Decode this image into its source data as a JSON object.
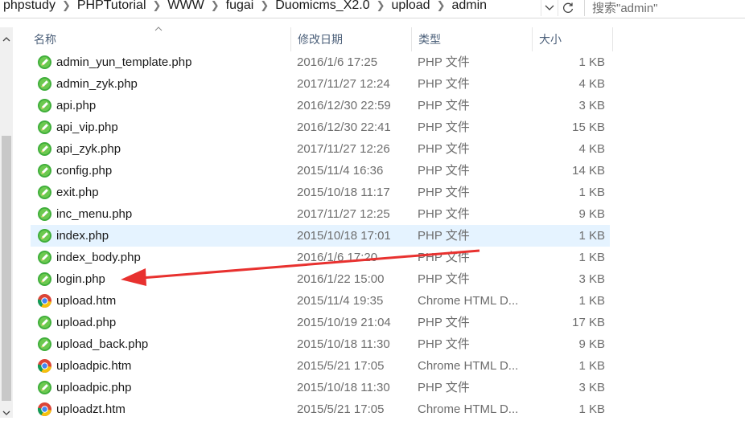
{
  "address_bar": {
    "crumbs": [
      "phpstudy",
      "PHPTutorial",
      "WWW",
      "fugai",
      "Duomicms_X2.0",
      "upload",
      "admin"
    ],
    "search_placeholder": "搜索\"admin\""
  },
  "columns": {
    "name": "名称",
    "date": "修改日期",
    "type": "类型",
    "size": "大小"
  },
  "colors": {
    "selected_row": "#e5f3ff",
    "header_text": "#4c607a",
    "arrow": "#e8312f"
  },
  "files": [
    {
      "name": "admin_yun_template.php",
      "date": "2016/1/6 17:25",
      "type": "PHP 文件",
      "size": "1 KB",
      "icon": "php-file-icon"
    },
    {
      "name": "admin_zyk.php",
      "date": "2017/11/27 12:24",
      "type": "PHP 文件",
      "size": "4 KB",
      "icon": "php-file-icon"
    },
    {
      "name": "api.php",
      "date": "2016/12/30 22:59",
      "type": "PHP 文件",
      "size": "3 KB",
      "icon": "php-file-icon"
    },
    {
      "name": "api_vip.php",
      "date": "2016/12/30 22:41",
      "type": "PHP 文件",
      "size": "15 KB",
      "icon": "php-file-icon"
    },
    {
      "name": "api_zyk.php",
      "date": "2017/11/27 12:26",
      "type": "PHP 文件",
      "size": "4 KB",
      "icon": "php-file-icon"
    },
    {
      "name": "config.php",
      "date": "2015/11/4 16:36",
      "type": "PHP 文件",
      "size": "14 KB",
      "icon": "php-file-icon"
    },
    {
      "name": "exit.php",
      "date": "2015/10/18 11:17",
      "type": "PHP 文件",
      "size": "1 KB",
      "icon": "php-file-icon"
    },
    {
      "name": "inc_menu.php",
      "date": "2017/11/27 12:25",
      "type": "PHP 文件",
      "size": "9 KB",
      "icon": "php-file-icon"
    },
    {
      "name": "index.php",
      "date": "2015/10/18 17:01",
      "type": "PHP 文件",
      "size": "1 KB",
      "icon": "php-file-icon",
      "selected": true
    },
    {
      "name": "index_body.php",
      "date": "2016/1/6 17:20",
      "type": "PHP 文件",
      "size": "1 KB",
      "icon": "php-file-icon"
    },
    {
      "name": "login.php",
      "date": "2016/1/22 15:00",
      "type": "PHP 文件",
      "size": "3 KB",
      "icon": "php-file-icon"
    },
    {
      "name": "upload.htm",
      "date": "2015/11/4 19:35",
      "type": "Chrome HTML D...",
      "size": "1 KB",
      "icon": "chrome-html-icon"
    },
    {
      "name": "upload.php",
      "date": "2015/10/19 21:04",
      "type": "PHP 文件",
      "size": "17 KB",
      "icon": "php-file-icon"
    },
    {
      "name": "upload_back.php",
      "date": "2015/10/18 11:30",
      "type": "PHP 文件",
      "size": "9 KB",
      "icon": "php-file-icon"
    },
    {
      "name": "uploadpic.htm",
      "date": "2015/5/21 17:05",
      "type": "Chrome HTML D...",
      "size": "1 KB",
      "icon": "chrome-html-icon"
    },
    {
      "name": "uploadpic.php",
      "date": "2015/10/18 11:30",
      "type": "PHP 文件",
      "size": "3 KB",
      "icon": "php-file-icon"
    },
    {
      "name": "uploadzt.htm",
      "date": "2015/5/21 17:05",
      "type": "Chrome HTML D...",
      "size": "1 KB",
      "icon": "chrome-html-icon"
    }
  ]
}
